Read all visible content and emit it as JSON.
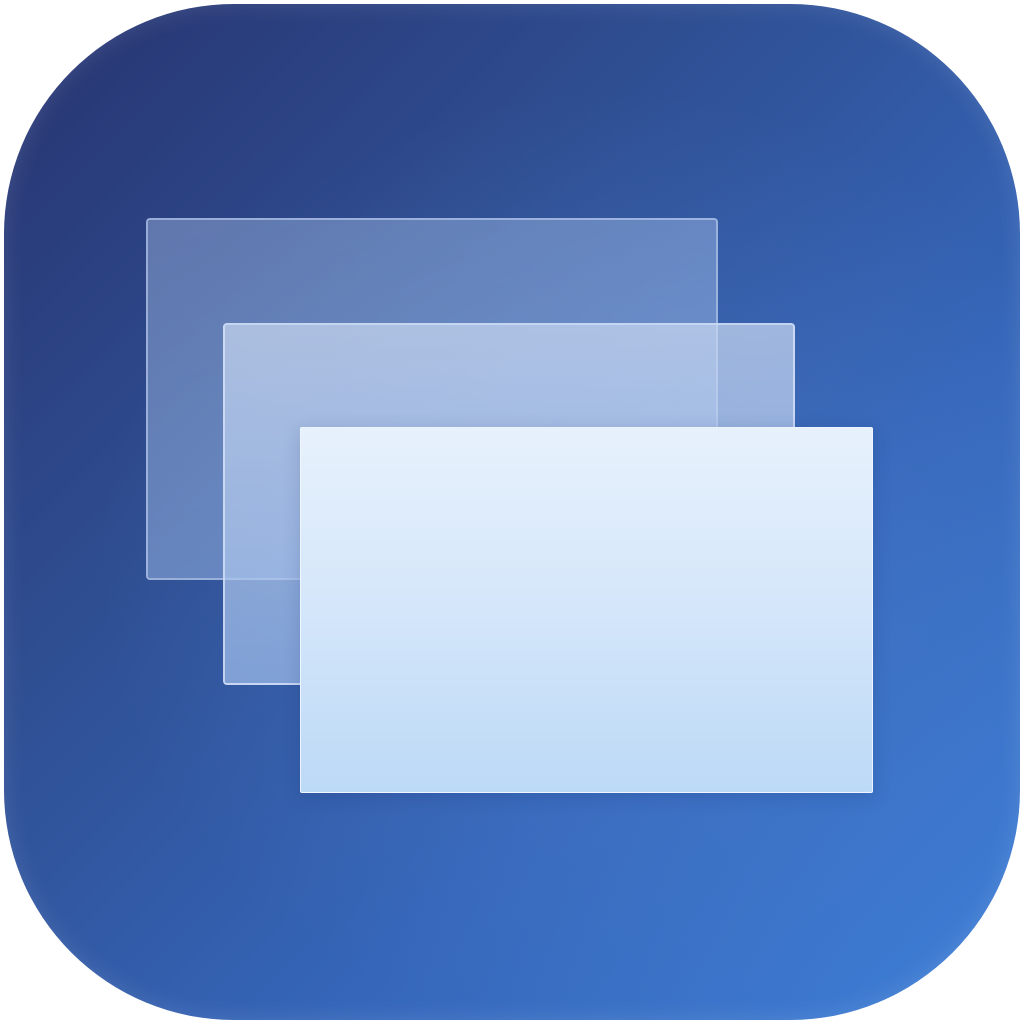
{
  "icon": {
    "name": "stacked-windows-app-icon",
    "colors": {
      "background_top_left": "#27336f",
      "background_bottom_right": "#3f80d8",
      "window_back": "#9db4df",
      "window_middle": "#b3c8ea",
      "window_front": "#d4e6fa"
    },
    "layers": [
      "back-window",
      "middle-window",
      "front-window"
    ]
  }
}
